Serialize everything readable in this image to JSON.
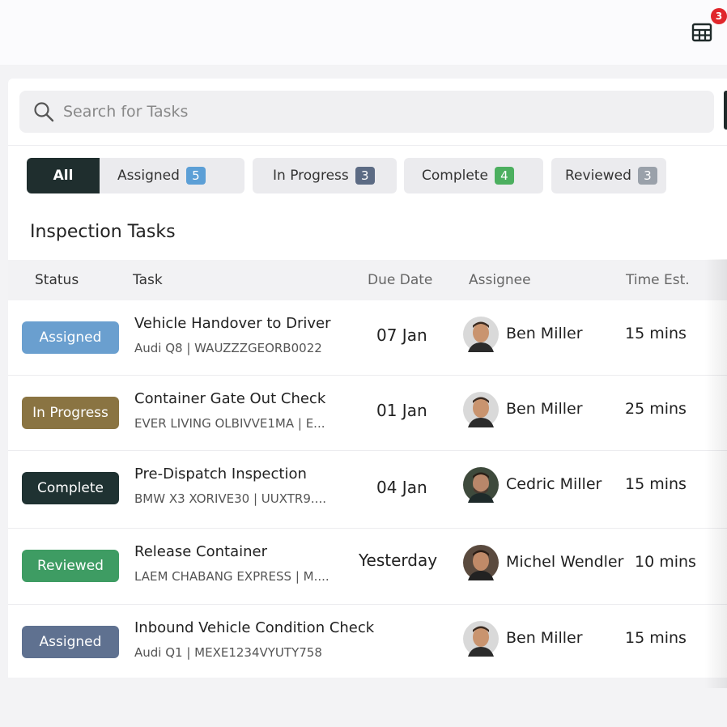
{
  "header": {
    "notification_count": "3",
    "grid_icon": "grid-icon"
  },
  "search": {
    "placeholder": "Search for Tasks",
    "value": ""
  },
  "filters": [
    {
      "label": "All",
      "count": ""
    },
    {
      "label": "Assigned",
      "count": "5",
      "color": "#5c9fd6"
    },
    {
      "label": "In Progress",
      "count": "3",
      "color": "#5c6b84"
    },
    {
      "label": "Complete",
      "count": "4",
      "color": "#4caf5f"
    },
    {
      "label": "Reviewed",
      "count": "3",
      "color": "#9aa1aa"
    }
  ],
  "section_title": "Inspection Tasks",
  "table": {
    "columns": [
      "Status",
      "Task",
      "Due Date",
      "Assignee",
      "Time Est."
    ],
    "rows": [
      {
        "status": "Assigned",
        "status_color": "#6a9fcf",
        "title": "Vehicle Handover to Driver",
        "subtitle": "Audi Q8 | WAUZZZGEORB0022",
        "due": "07 Jan",
        "assignee": "Ben Miller",
        "time": "15 mins"
      },
      {
        "status": "In Progress",
        "status_color": "#8a7442",
        "title": "Container Gate Out Check",
        "subtitle": "EVER LIVING OLBIVVE1MA | E...",
        "due": "01 Jan",
        "assignee": "Ben Miller",
        "time": "25 mins"
      },
      {
        "status": "Complete",
        "status_color": "#1f3232",
        "title": "Pre-Dispatch Inspection",
        "subtitle": "BMW X3 XORIVE30 | UUXTR9....",
        "due": "04 Jan",
        "assignee": "Cedric Miller",
        "time": "15 mins"
      },
      {
        "status": "Reviewed",
        "status_color": "#3e9c63",
        "title": "Release Container",
        "subtitle": "LAEM CHABANG EXPRESS | M....",
        "due": "Yesterday",
        "assignee": "Michel Wendler",
        "time": "10 mins"
      },
      {
        "status": "Assigned",
        "status_color": "#5f7190",
        "title": "Inbound Vehicle Condition Check",
        "subtitle": "Audi Q1 | MEXE1234VYUTY758",
        "due": "",
        "assignee": "Ben Miller",
        "time": "15 mins"
      }
    ]
  }
}
